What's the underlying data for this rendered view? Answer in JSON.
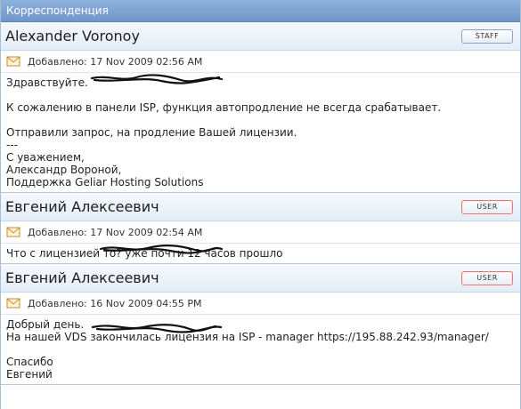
{
  "panel": {
    "title": "Корреспонденция"
  },
  "messages": [
    {
      "author": "Alexander Voronoy",
      "role": "STAFF",
      "meta": "Добавлено: 17 Nov 2009 02:56 AM",
      "body": "Здравствуйте.\n\nК сожалению в панели ISP, функция автопродление не всегда срабатывает.\n\nОтправили запрос, на продление Вашей лицензии.\n---\nС уважением,\nАлександр Вороной,\nПоддержка Geliar Hosting Solutions"
    },
    {
      "author": "Евгений Алексеевич",
      "role": "USER",
      "meta": "Добавлено: 17 Nov 2009 02:54 AM",
      "body": "Что с лицензией то? уже почти 12 часов прошло"
    },
    {
      "author": "Евгений Алексеевич",
      "role": "USER",
      "meta": "Добавлено: 16 Nov 2009 04:55 PM",
      "body": "Добрый день.\nНа нашей VDS закончилась лицензия на ISP - manager https://195.88.242.93/manager/\n\nСпасибо\nЕвгений"
    }
  ],
  "icons": {
    "meta": "envelope-icon"
  },
  "colors": {
    "header": "#7ea6d4",
    "staff_border": "#8ea4c0",
    "user_border": "#dd7c7c",
    "scribble": "#111111"
  }
}
